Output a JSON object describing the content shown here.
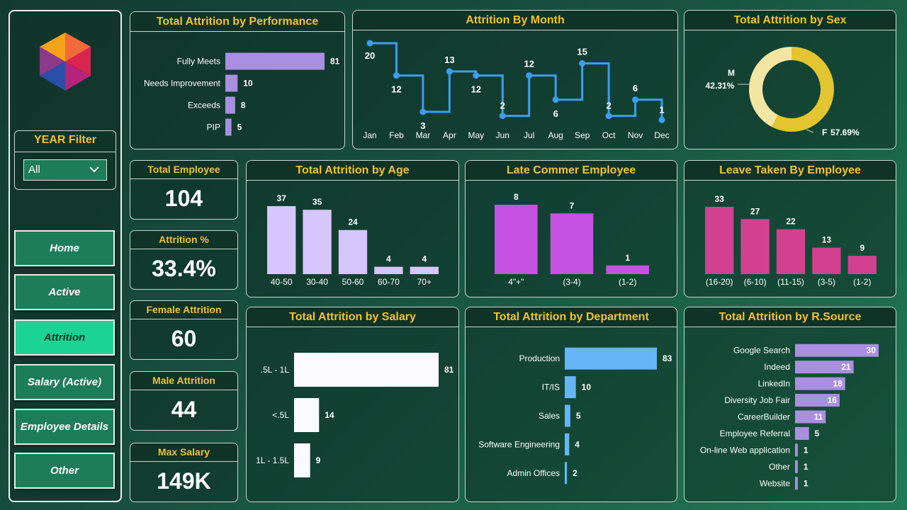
{
  "sidebar": {
    "year_filter": {
      "title": "YEAR Filter",
      "selected": "All"
    },
    "nav": [
      {
        "label": "Home",
        "active": false
      },
      {
        "label": "Active",
        "active": false
      },
      {
        "label": "Attrition",
        "active": true
      },
      {
        "label": "Salary (Active)",
        "active": false
      },
      {
        "label": "Employee Details",
        "active": false
      },
      {
        "label": "Other",
        "active": false
      }
    ]
  },
  "kpis": [
    {
      "title": "Total Employee",
      "value": "104"
    },
    {
      "title": "Attrition %",
      "value": "33.4%"
    },
    {
      "title": "Female Attrition",
      "value": "60"
    },
    {
      "title": "Male Attrition",
      "value": "44"
    },
    {
      "title": "Max Salary",
      "value": "149K"
    }
  ],
  "colors": {
    "lavender": "#a98fe0",
    "light_lavender": "#d6c6fb",
    "magenta": "#c552e0",
    "pink": "#d2418f",
    "blue": "#3d9df0",
    "sky": "#66b5f6",
    "white": "#fbfbff",
    "gold": "#e3c531",
    "cream": "#f3e6a3",
    "title": "#f2c230"
  },
  "chart_data": [
    {
      "id": "performance",
      "type": "bar",
      "orientation": "horizontal",
      "title": "Total Attrition by Performance",
      "categories": [
        "Fully Meets",
        "Needs Improvement",
        "Exceeds",
        "PIP"
      ],
      "values": [
        81,
        10,
        8,
        5
      ]
    },
    {
      "id": "month",
      "type": "line",
      "step": true,
      "title": "Attrition By Month",
      "categories": [
        "Jan",
        "Feb",
        "Mar",
        "Apr",
        "May",
        "Jun",
        "Jul",
        "Aug",
        "Sep",
        "Oct",
        "Nov",
        "Dec"
      ],
      "values": [
        20,
        12,
        3,
        13,
        12,
        2,
        12,
        6,
        15,
        2,
        6,
        1
      ]
    },
    {
      "id": "sex",
      "type": "pie",
      "donut": true,
      "title": "Total Attrition by Sex",
      "slices": [
        {
          "label": "M",
          "value": 42.31,
          "display": "42.31%"
        },
        {
          "label": "F",
          "value": 57.69,
          "display": "57.69%"
        }
      ]
    },
    {
      "id": "age",
      "type": "bar",
      "title": "Total Attrition by Age",
      "categories": [
        "40-50",
        "30-40",
        "50-60",
        "60-70",
        "70+"
      ],
      "values": [
        37,
        35,
        24,
        4,
        4
      ]
    },
    {
      "id": "late",
      "type": "bar",
      "title": "Late Commer Employee",
      "categories": [
        "4\"+\"",
        "(3-4)",
        "(1-2)"
      ],
      "values": [
        8,
        7,
        1
      ]
    },
    {
      "id": "leave",
      "type": "bar",
      "title": "Leave Taken By Employee",
      "categories": [
        "(16-20)",
        "(6-10)",
        "(11-15)",
        "(3-5)",
        "(1-2)"
      ],
      "values": [
        33,
        27,
        22,
        13,
        9
      ]
    },
    {
      "id": "salary",
      "type": "bar",
      "orientation": "horizontal",
      "title": "Total Attrition by Salary",
      "categories": [
        ".5L - 1L",
        "<.5L",
        "1L - 1.5L"
      ],
      "values": [
        81,
        14,
        9
      ]
    },
    {
      "id": "department",
      "type": "bar",
      "orientation": "horizontal",
      "title": "Total Attrition by Department",
      "categories": [
        "Production",
        "IT/IS",
        "Sales",
        "Software Engineering",
        "Admin Offices"
      ],
      "values": [
        83,
        10,
        5,
        4,
        2
      ]
    },
    {
      "id": "source",
      "type": "bar",
      "orientation": "horizontal",
      "title": "Total Attrition by R.Source",
      "categories": [
        "Google Search",
        "Indeed",
        "LinkedIn",
        "Diversity Job Fair",
        "CareerBuilder",
        "Employee Referral",
        "On-line Web application",
        "Other",
        "Website"
      ],
      "values": [
        30,
        21,
        18,
        16,
        11,
        5,
        1,
        1,
        1
      ]
    }
  ]
}
